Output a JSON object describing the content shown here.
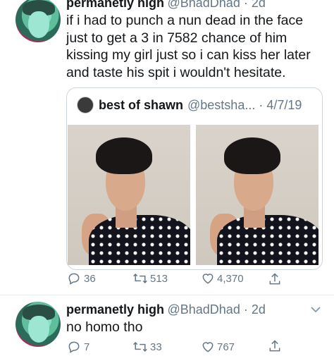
{
  "tweet1": {
    "name": "permanetly high",
    "handle_time": "@BhadDhad · 2d",
    "text_lines": [
      "if i had to punch a nun dead in the face",
      "just to get a 3 in 7582 chance of him",
      "kissing my girl just so i can kiss her later",
      "and taste his spit i wouldn't hesitate."
    ],
    "quoted": {
      "name": "best of shawn",
      "handle_time": "@bestsha... · 4/7/19"
    },
    "actions": {
      "replies": "36",
      "retweets": "513",
      "likes": "4,370"
    }
  },
  "tweet2": {
    "name": "permanetly high",
    "handle_time": "@BhadDhad · 2d",
    "text": "no homo tho",
    "actions": {
      "replies": "7",
      "retweets": "33",
      "likes": "767"
    }
  },
  "colors": {
    "text": "#14171a",
    "muted": "#657786",
    "border": "#ccd6dd"
  },
  "icons": [
    "reply-icon",
    "retweet-icon",
    "like-icon",
    "share-icon",
    "chevron-down-icon"
  ]
}
